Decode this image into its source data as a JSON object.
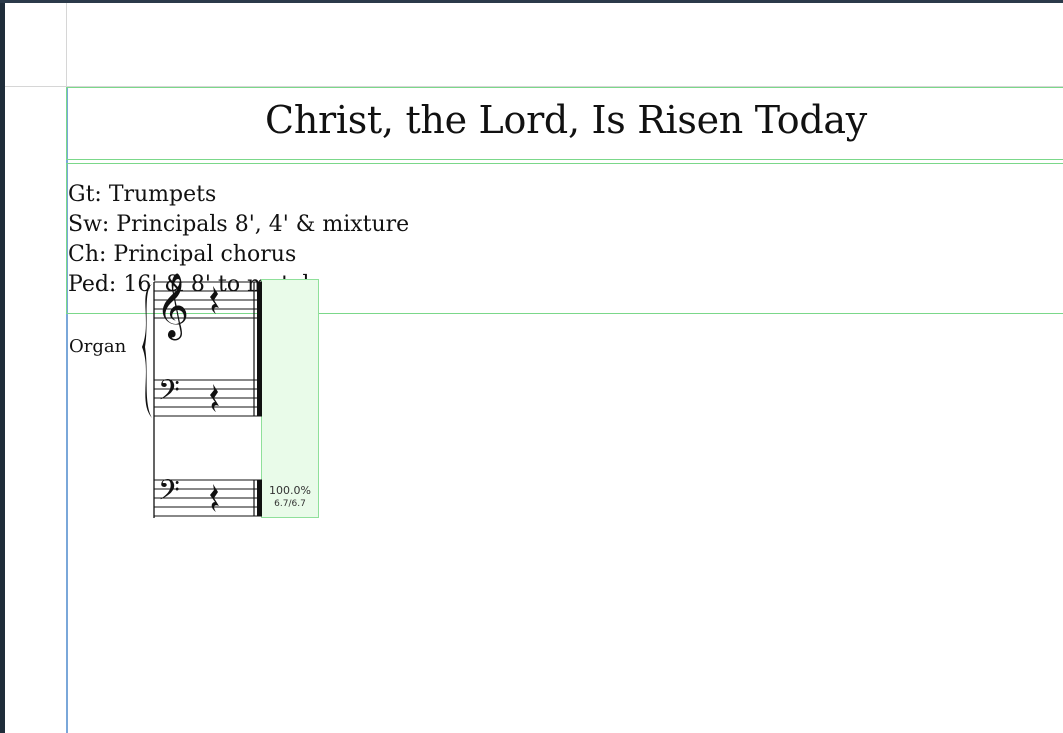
{
  "score": {
    "title": "Christ, the Lord, Is Risen Today",
    "registration": [
      "Gt: Trumpets",
      "Sw: Principals 8', 4' & mixture",
      "Ch: Principal chorus",
      "Ped: 16' & 8' to match"
    ],
    "instrument": "Organ"
  },
  "measure_info": {
    "fill_percent": "100.0%",
    "duration": "6.7/6.7"
  },
  "colors": {
    "frame_border": "#7bd88a",
    "measure_highlight": "#e9fbe9",
    "left_margin_line": "#7aa7d9"
  }
}
